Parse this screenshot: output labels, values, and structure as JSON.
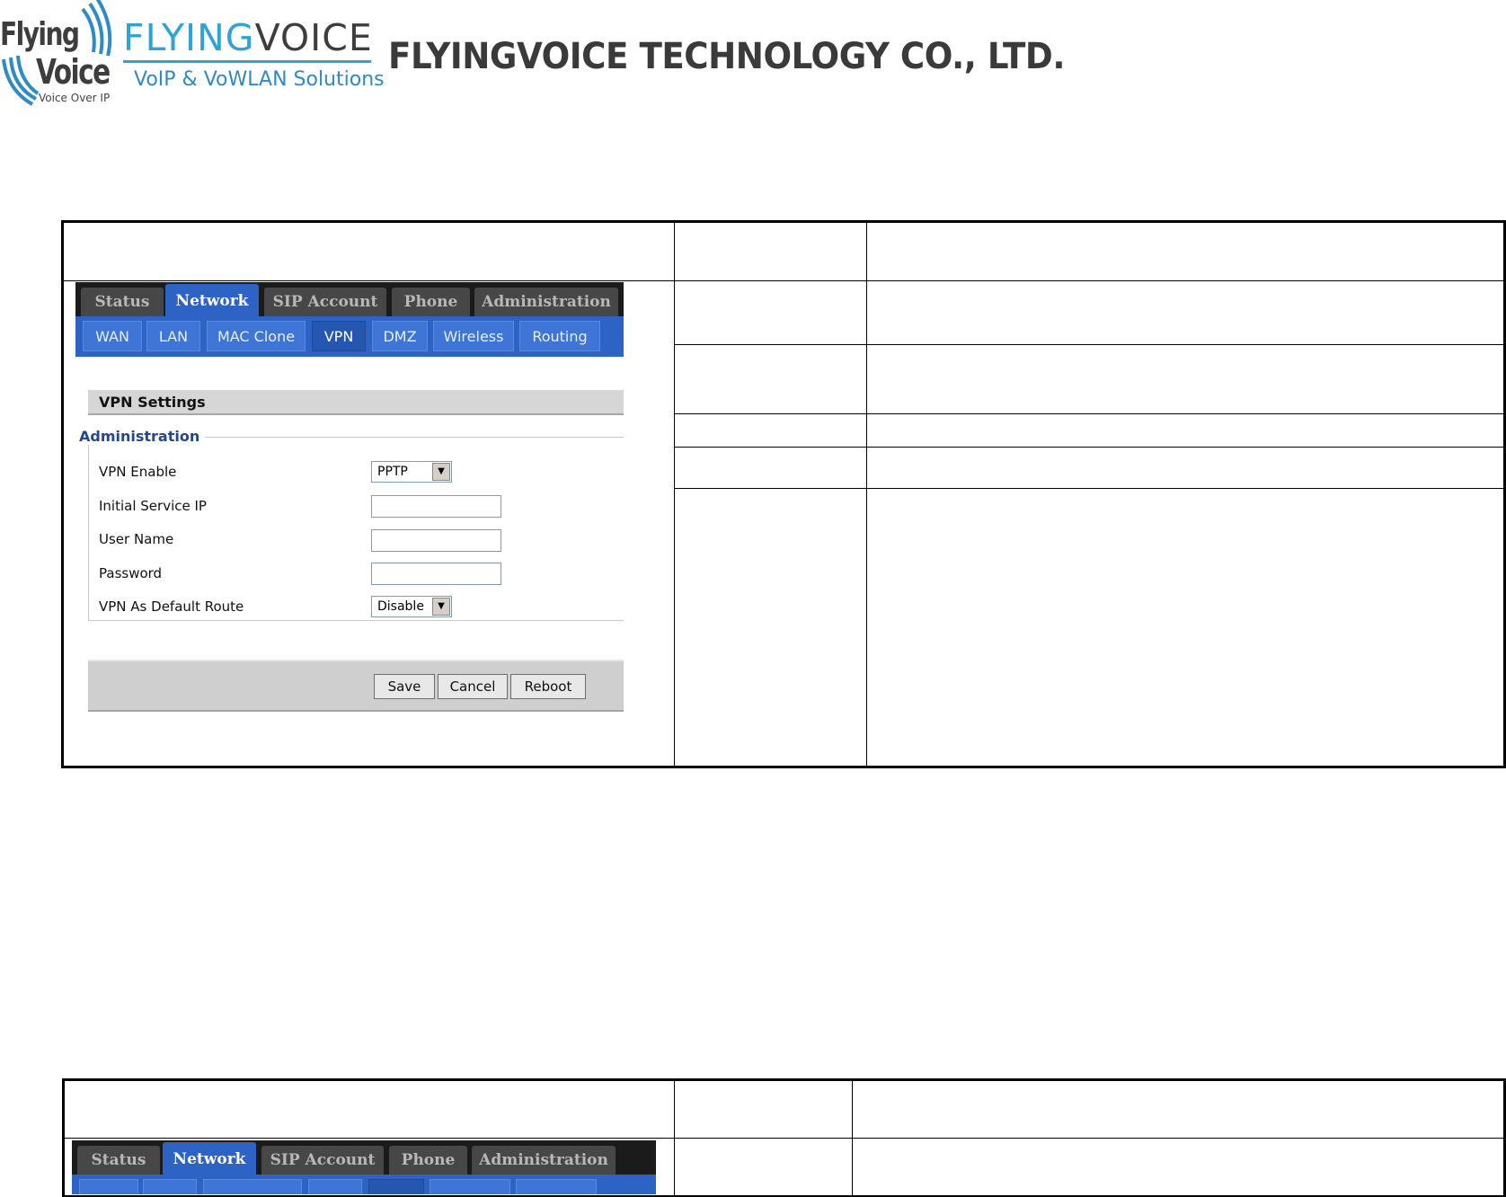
{
  "header": {
    "logo_primary_line1": "Flying",
    "logo_primary_line2": "Voice",
    "logo_primary_tagline": "Voice Over IP",
    "brand_part1": "FLYING",
    "brand_part2": "VOICE",
    "brand_tagline": "VoIP & VoWLAN Solutions",
    "company": "FLYINGVOICE TECHNOLOGY CO., LTD."
  },
  "router1": {
    "main_tabs": [
      {
        "label": "Status"
      },
      {
        "label": "Network"
      },
      {
        "label": "SIP Account"
      },
      {
        "label": "Phone"
      },
      {
        "label": "Administration"
      }
    ],
    "active_main_tab": "Network",
    "sub_tabs": [
      {
        "label": "WAN"
      },
      {
        "label": "LAN"
      },
      {
        "label": "MAC Clone"
      },
      {
        "label": "VPN"
      },
      {
        "label": "DMZ"
      },
      {
        "label": "Wireless"
      },
      {
        "label": "Routing"
      }
    ],
    "active_sub_tab": "VPN",
    "section_title": "VPN Settings",
    "group_legend": "Administration",
    "fields": [
      {
        "label": "VPN Enable",
        "type": "select",
        "value": "PPTP"
      },
      {
        "label": "Initial Service IP",
        "type": "text",
        "value": ""
      },
      {
        "label": "User Name",
        "type": "text",
        "value": ""
      },
      {
        "label": "Password",
        "type": "password",
        "value": ""
      },
      {
        "label": "VPN As Default Route",
        "type": "select",
        "value": "Disable"
      }
    ],
    "buttons": [
      {
        "label": "Save"
      },
      {
        "label": "Cancel"
      },
      {
        "label": "Reboot"
      }
    ]
  },
  "router2": {
    "main_tabs": [
      {
        "label": "Status"
      },
      {
        "label": "Network"
      },
      {
        "label": "SIP Account"
      },
      {
        "label": "Phone"
      },
      {
        "label": "Administration"
      }
    ],
    "active_main_tab": "Network"
  },
  "colors": {
    "tab_bar": "#1b1b1b",
    "tab_inactive": "#474747",
    "tab_active": "#2d63c4",
    "sub_bar": "#2d63c4",
    "brand_blue": "#2ea3d6",
    "legend_blue": "#24488a"
  }
}
